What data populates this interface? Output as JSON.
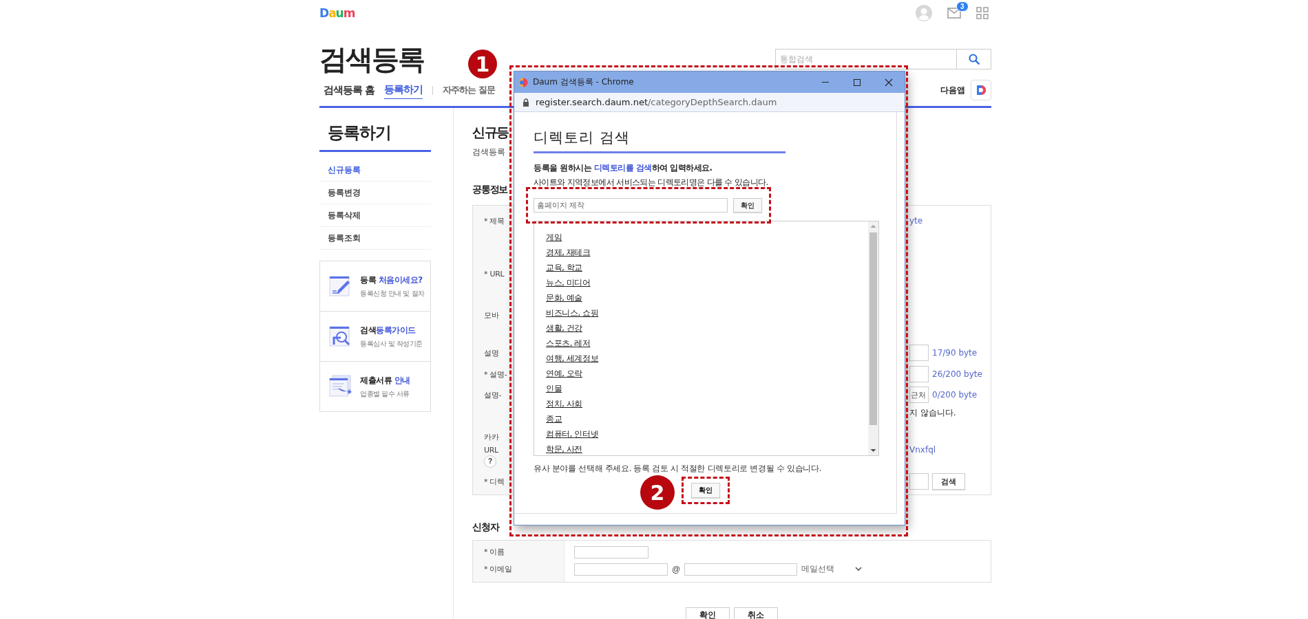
{
  "header": {
    "logo": "Daum",
    "mail_count": "3"
  },
  "site_title": "검색등록",
  "site_search": {
    "placeholder": "통합검색"
  },
  "nav": [
    {
      "label": "검색등록 홈",
      "selected": false
    },
    {
      "label": "등록하기",
      "selected": true
    },
    {
      "label": "자주하는 질문",
      "selected": false
    }
  ],
  "app_link": {
    "label": "다음앱"
  },
  "sidebar": {
    "title": "등록하기",
    "items": [
      {
        "label": "신규등록",
        "selected": true
      },
      {
        "label": "등록변경",
        "selected": false
      },
      {
        "label": "등록삭제",
        "selected": false
      },
      {
        "label": "등록조회",
        "selected": false
      }
    ],
    "guides": [
      {
        "kind": "pencil",
        "parts": [
          {
            "text": "등록 ",
            "highlight": false
          },
          {
            "text": "처음이세요?",
            "highlight": true
          }
        ],
        "subtitle": "등록신청 안내 및 절차"
      },
      {
        "kind": "magnifier",
        "parts": [
          {
            "text": "검색",
            "highlight": false
          },
          {
            "text": "등록가이드",
            "highlight": true
          }
        ],
        "subtitle": "등록심사 및 작성기준"
      },
      {
        "kind": "documents",
        "parts": [
          {
            "text": "제출서류 ",
            "highlight": false
          },
          {
            "text": "안내",
            "highlight": true
          }
        ],
        "subtitle": "업종별 필수 서류"
      }
    ]
  },
  "main": {
    "title": "신규등",
    "subtitle": "검색등록",
    "common_info": {
      "heading": "공통정보",
      "rows": [
        {
          "kind": "text",
          "label": "* 제목",
          "text": "yte"
        },
        {
          "kind": "plain",
          "label": "* URL"
        },
        {
          "kind": "plain",
          "label": "모바"
        },
        {
          "kind": "counter",
          "label": "설명",
          "counter": "17/90 byte"
        },
        {
          "kind": "counter",
          "label": "* 설명-",
          "counter": "26/200 byte"
        },
        {
          "kind": "counter",
          "label": "설명-",
          "field_value": "근처",
          "counter": "0/200 byte"
        },
        {
          "kind": "note",
          "text": "지 않습니다."
        },
        {
          "kind": "plain",
          "label": "카카"
        },
        {
          "kind": "link",
          "label": "URL",
          "text": "Vnxfql"
        },
        {
          "kind": "help",
          "help": "?"
        },
        {
          "kind": "search",
          "label": "* 디렉",
          "button": "검색"
        }
      ]
    },
    "applicant": {
      "heading": "신청자",
      "rows": [
        {
          "kind": "name",
          "label": "* 이름"
        },
        {
          "kind": "email",
          "label": "* 이메일",
          "at": "@",
          "select": "메일선택"
        }
      ]
    },
    "buttons": [
      "확인",
      "취소"
    ]
  },
  "popup": {
    "title": "Daum 검색등록 - Chrome",
    "url_host": "register.search.daum.net",
    "url_path": "/categoryDepthSearch.daum",
    "heading": "디렉토리 검색",
    "intro_parts": [
      {
        "text": "등록을 원하시는 ",
        "highlight": false
      },
      {
        "text": "디렉토리를 검색",
        "highlight": true
      },
      {
        "text": "하여 입력하세요.",
        "highlight": false
      }
    ],
    "note": "사이트와 지역정보에서 서비스되는 디렉토리명은 다를 수 있습니다.",
    "search_value": "홈페이지 제작",
    "search_button": "확인",
    "categories": [
      "게임",
      "경제, 재테크",
      "교육, 학교",
      "뉴스, 미디어",
      "문화, 예술",
      "비즈니스, 쇼핑",
      "생활, 건강",
      "스포츠, 레저",
      "여행, 세계정보",
      "연예, 오락",
      "인물",
      "정치, 사회",
      "종교",
      "컴퓨터, 인터넷",
      "학문, 사전"
    ],
    "hint": "유사 분야를 선택해 주세요. 등록 검토 시 적절한 디렉토리로 변경될 수 있습니다.",
    "confirm_button": "확인"
  },
  "annotations": [
    {
      "number": "1"
    },
    {
      "number": "2"
    }
  ]
}
